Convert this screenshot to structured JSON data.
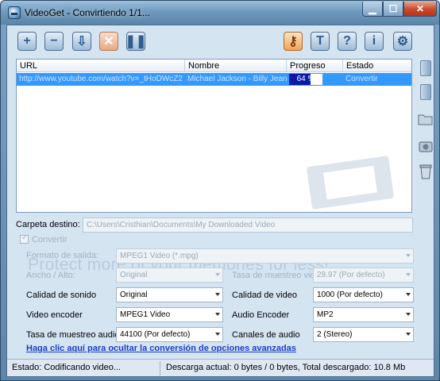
{
  "window": {
    "title": "VideoGet - Convirtiendo 1/1..."
  },
  "toolbar": {
    "left_icons": [
      "add-icon",
      "remove-icon",
      "download-icon",
      "cancel-icon",
      "pause-icon"
    ],
    "right_icons": [
      "key-icon",
      "settings-icon",
      "help-icon",
      "info-icon",
      "options-icon"
    ]
  },
  "list": {
    "columns": [
      "URL",
      "Nombre",
      "Progreso",
      "Estado"
    ],
    "rows": [
      {
        "url": "http://www.youtube.com/watch?v=_tHoDWcZ2",
        "name": "Michael Jackson - Billy Jean",
        "progress_text": "64 %",
        "progress": 0.64,
        "status": "Convertir"
      }
    ]
  },
  "sidebar_icons": [
    "move-up-icon",
    "move-down-icon",
    "folder-open-icon",
    "camera-icon",
    "recycle-bin-icon"
  ],
  "form": {
    "dest_label": "Carpeta destino:",
    "dest_value": "C:\\Users\\Cristhian\\Documents\\My Downloaded Video",
    "convert_label": "Convertir",
    "promo": "Protect more of your memories for less!",
    "output_format_label": "Formato de salida:",
    "output_format_value": "MPEG1 Video (*.mpg)",
    "size_label": "Ancho / Alto:",
    "size_value": "Original",
    "video_rate_label": "Tasa de muestreo video:",
    "video_rate_value": "29.97 (Por defecto)",
    "sound_quality_label": "Calidad de sonido",
    "sound_quality_value": "Original",
    "video_quality_label": "Calidad de video",
    "video_quality_value": "1000 (Por defecto)",
    "video_encoder_label": "Video encoder",
    "video_encoder_value": "MPEG1 Video",
    "audio_encoder_label": "Audio Encoder",
    "audio_encoder_value": "MP2",
    "audio_rate_label": "Tasa de muestreo audio:",
    "audio_rate_value": "44100 (Por defecto)",
    "channels_label": "Canales de audio",
    "channels_value": "2 (Stereo)",
    "hide_advanced_link": "Haga clic aquí para ocultar la conversión de opciones avanzadas"
  },
  "status": {
    "state": "Estado: Codificando video...",
    "downloads": "Descarga actual: 0 bytes / 0 bytes,  Total descargado: 10.8 Mb"
  }
}
